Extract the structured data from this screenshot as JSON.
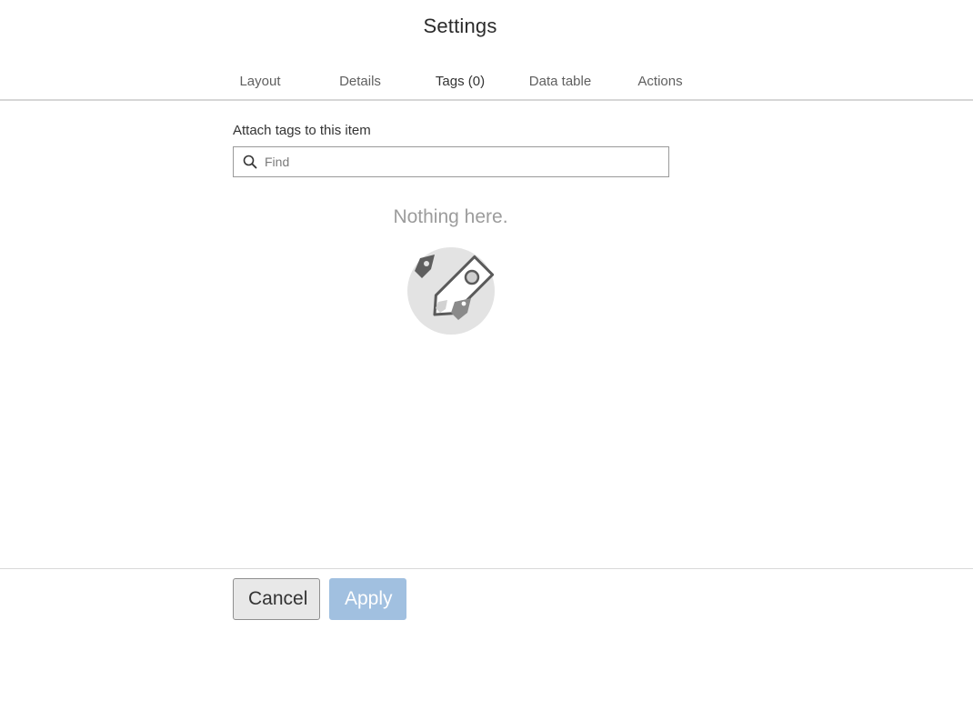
{
  "dialog": {
    "title": "Settings"
  },
  "tabs": [
    {
      "label": "Layout",
      "active": false
    },
    {
      "label": "Details",
      "active": false
    },
    {
      "label": "Tags (0)",
      "active": true
    },
    {
      "label": "Data table",
      "active": false
    },
    {
      "label": "Actions",
      "active": false
    }
  ],
  "tags_panel": {
    "field_label": "Attach tags to this item",
    "search": {
      "placeholder": "Find",
      "value": "",
      "icon": "search-icon"
    },
    "empty_state": {
      "message": "Nothing here.",
      "icon": "tags-icon"
    }
  },
  "footer": {
    "cancel_label": "Cancel",
    "apply_label": "Apply",
    "apply_enabled": false
  },
  "colors": {
    "accent": "#2e74c0",
    "apply_disabled_bg": "#a1c0e0",
    "empty_text": "#9c9c9c"
  }
}
